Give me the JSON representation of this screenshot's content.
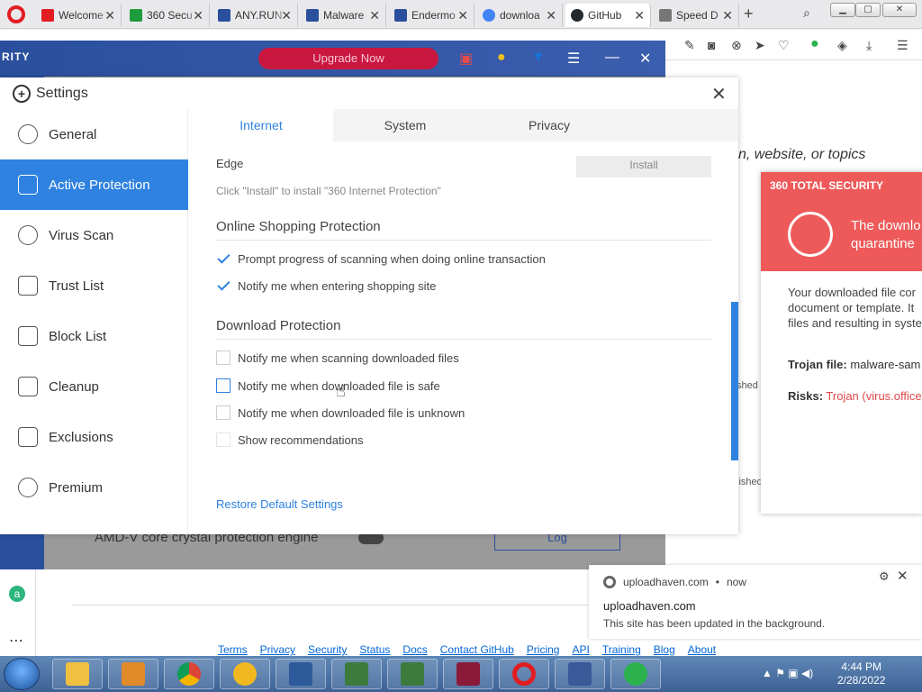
{
  "browser": {
    "tabs": [
      {
        "label": "Welcome",
        "color": "#e11d22"
      },
      {
        "label": "360 Secu",
        "color": "#1e9c3c"
      },
      {
        "label": "ANY.RUN",
        "color": "#2a4f9d"
      },
      {
        "label": "Malware",
        "color": "#2a4f9d"
      },
      {
        "label": "Endermo",
        "color": "#2a4f9d"
      },
      {
        "label": "downloa",
        "color": "#4285f4"
      },
      {
        "label": "GitHub",
        "color": "#24292e"
      },
      {
        "label": "Speed D",
        "color": "#777777"
      }
    ]
  },
  "win360": {
    "brand_fragment": "RITY",
    "upgrade_label": "Upgrade Now",
    "amdv_label": "AMD-V core crystal protection engine",
    "log_label": "Log"
  },
  "settings": {
    "title": "Settings",
    "nav": [
      {
        "label": "General",
        "icon": "gear-icon"
      },
      {
        "label": "Active Protection",
        "icon": "shield-icon"
      },
      {
        "label": "Virus Scan",
        "icon": "radar-icon"
      },
      {
        "label": "Trust List",
        "icon": "trust-list-icon"
      },
      {
        "label": "Block List",
        "icon": "block-list-icon"
      },
      {
        "label": "Cleanup",
        "icon": "broom-icon"
      },
      {
        "label": "Exclusions",
        "icon": "folder-icon"
      },
      {
        "label": "Premium",
        "icon": "crown-icon"
      }
    ],
    "active_nav": "Active Protection",
    "tabs": [
      "Internet",
      "System",
      "Privacy"
    ],
    "active_tab": "Internet",
    "edge_label": "Edge",
    "install_label": "Install",
    "install_hint": "Click \"Install\" to install \"360 Internet Protection\"",
    "shopping": {
      "heading": "Online Shopping Protection",
      "options": [
        {
          "label": "Prompt progress of scanning when doing online transaction",
          "checked": true
        },
        {
          "label": "Notify me when entering shopping site",
          "checked": true
        }
      ]
    },
    "download": {
      "heading": "Download Protection",
      "options": [
        {
          "label": "Notify me when scanning downloaded files",
          "checked": false
        },
        {
          "label": "Notify me when downloaded file is safe",
          "checked": false
        },
        {
          "label": "Notify me when downloaded file is unknown",
          "checked": false
        },
        {
          "label": "Show recommendations",
          "checked": false
        }
      ]
    },
    "restore_label": "Restore Default Settings"
  },
  "github": {
    "search_hint_fragment": "n, website, or topics",
    "side_fragment_1": "shed",
    "side_fragment_2": "lished",
    "footer": [
      "Terms",
      "Privacy",
      "Security",
      "Status",
      "Docs",
      "Contact GitHub",
      "Pricing",
      "API",
      "Training",
      "Blog",
      "About"
    ]
  },
  "popup": {
    "brand": "360 TOTAL SECURITY",
    "message_line1": "The downlo",
    "message_line2": "quarantine",
    "body_line1": "Your downloaded file cor",
    "body_line2": "document or template. It",
    "body_line3": "files and resulting in syste",
    "trojan_label": "Trojan file:",
    "trojan_value": "malware-sam",
    "risks_label": "Risks:",
    "risks_value": "Trojan (virus.office."
  },
  "toast": {
    "source": "uploadhaven.com",
    "time": "now",
    "title": "uploadhaven.com",
    "body": "This site has been updated in the background."
  },
  "taskbar": {
    "time": "4:44 PM",
    "date": "2/28/2022"
  }
}
